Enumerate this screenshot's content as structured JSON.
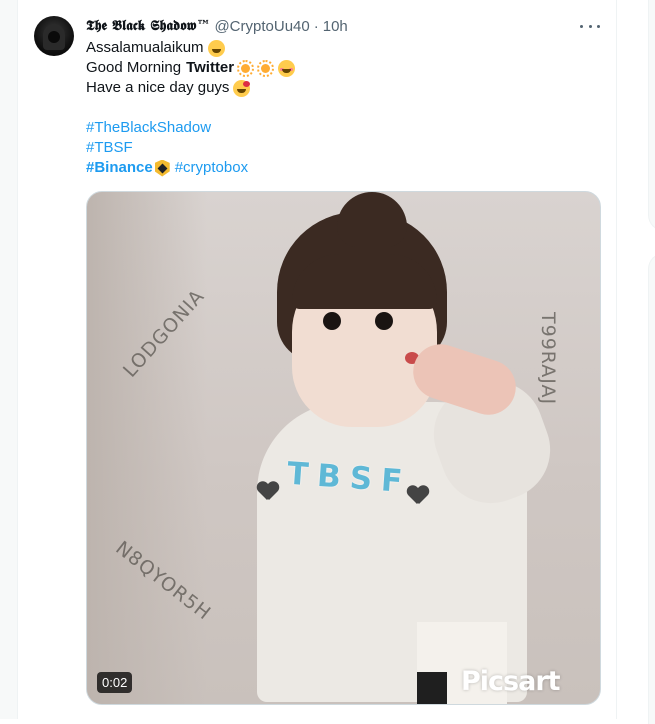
{
  "tweet": {
    "display_name": "𝕿𝖍𝖊 𝕭𝖑𝖆𝖈𝖐 𝕾𝖍𝖆𝖉𝖔𝖜™",
    "handle": "@CryptoUu40",
    "separator": "·",
    "time": "10h",
    "lines": {
      "line1": "Assalamualaikum",
      "line2_prefix": "Good Morning",
      "line2_bold": "Twitter",
      "line3": "Have a nice day guys",
      "hashtag1": "#TheBlackShadow",
      "hashtag2": "#TBSF",
      "hashtag3": "#Binance",
      "hashtag4": "#cryptobox"
    },
    "emojis": [
      "wink-emoji",
      "sun-emoji",
      "sun-emoji",
      "smiling-face-emoji",
      "kiss-emoji",
      "binance-coin-emoji"
    ]
  },
  "media": {
    "watermarks": {
      "lodgonia": "LODGONIA",
      "t99": "T99RAJAJ",
      "n8q": "N8QYOR5H",
      "tbsf": "TBSF"
    },
    "duration": "0:02",
    "brand": "Picsart"
  },
  "colors": {
    "accent": "#1d9bf0",
    "text": "#0f1419",
    "secondary": "#536471",
    "border": "#cfd9de"
  }
}
